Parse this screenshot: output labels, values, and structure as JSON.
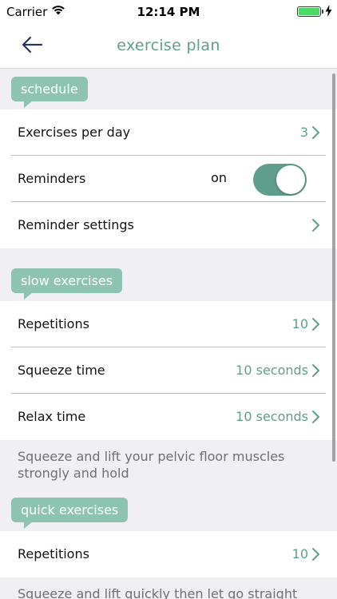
{
  "status_bar": {
    "carrier": "Carrier",
    "time": "12:14 PM",
    "battery_level": 1.0,
    "wifi_icon": "wifi-icon",
    "battery_icon": "battery-icon",
    "charging_icon": "bolt-icon"
  },
  "nav": {
    "title": "exercise plan",
    "back_icon": "back-arrow-icon"
  },
  "colors": {
    "accent": "#5e9e8a",
    "tag_bg": "#8cc4b1",
    "background": "#efeff4"
  },
  "schedule": {
    "tag": "schedule",
    "exercises_per_day": {
      "label": "Exercises per day",
      "value": "3"
    },
    "reminders": {
      "label": "Reminders",
      "state_text": "on",
      "enabled": true
    },
    "reminder_settings": {
      "label": "Reminder settings"
    }
  },
  "slow": {
    "tag": "slow exercises",
    "repetitions": {
      "label": "Repetitions",
      "value": "10"
    },
    "squeeze_time": {
      "label": "Squeeze time",
      "value": "10 seconds"
    },
    "relax_time": {
      "label": "Relax time",
      "value": "10 seconds"
    },
    "description": "Squeeze and lift your pelvic floor muscles strongly and hold"
  },
  "quick": {
    "tag": "quick exercises",
    "repetitions": {
      "label": "Repetitions",
      "value": "10"
    },
    "description": "Squeeze and lift quickly then let go straight"
  }
}
